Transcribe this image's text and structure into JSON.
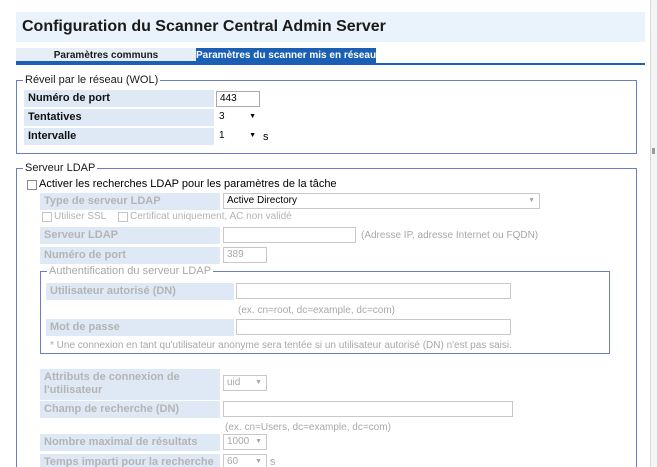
{
  "header": {
    "title": "Configuration du Scanner Central Admin Server"
  },
  "tabs": [
    {
      "label": "Paramètres communs",
      "active": false
    },
    {
      "label": "Paramètres du scanner mis en réseau",
      "active": true
    }
  ],
  "wol": {
    "legend": "Réveil par le réseau (WOL)",
    "port_label": "Numéro de port",
    "port_value": "443",
    "retries_label": "Tentatives",
    "retries_value": "3",
    "interval_label": "Intervalle",
    "interval_value": "1",
    "interval_unit": "s"
  },
  "ldap": {
    "legend": "Serveur LDAP",
    "enable_label": "Activer les recherches LDAP pour les paramètres de la tâche",
    "server_type_label": "Type de serveur LDAP",
    "server_type_value": "Active Directory",
    "ssl_label": "Utiliser SSL",
    "cert_label": "Certificat uniquement, AC non validé",
    "server_label": "Serveur LDAP",
    "server_value": "",
    "server_hint": "(Adresse IP, adresse Internet ou FQDN)",
    "port_label": "Numéro de port",
    "port_value": "389",
    "auth_legend": "Authentification du serveur LDAP",
    "user_label": "Utilisateur autorisé (DN)",
    "user_value": "",
    "user_hint": "(ex. cn=root, dc=example, dc=com)",
    "password_label": "Mot de passe",
    "password_value": "",
    "anon_note": "* Une connexion en tant qu'utilisateur anonyme sera tentée si un utilisateur autorisé (DN) n'est pas saisi.",
    "login_attr_label_1": "Attributs de connexion de",
    "login_attr_label_2": "l'utilisateur",
    "login_attr_value": "uid",
    "search_field_label": "Champ de recherche (DN)",
    "search_field_value": "",
    "search_field_hint": "(ex. cn=Users, dc=example, dc=com)",
    "max_results_label": "Nombre maximal de résultats",
    "max_results_value": "1000",
    "timeout_label": "Temps imparti pour la recherche",
    "timeout_value": "60",
    "timeout_unit": "s"
  },
  "icons": {
    "dropdown": "chevron-down-icon",
    "checkbox": "checkbox-icon"
  },
  "colors": {
    "accent": "#1a5fb4",
    "label_bg": "#dfe9f6",
    "border": "#6a7ec4",
    "disabled_text": "#b4b4b4"
  }
}
